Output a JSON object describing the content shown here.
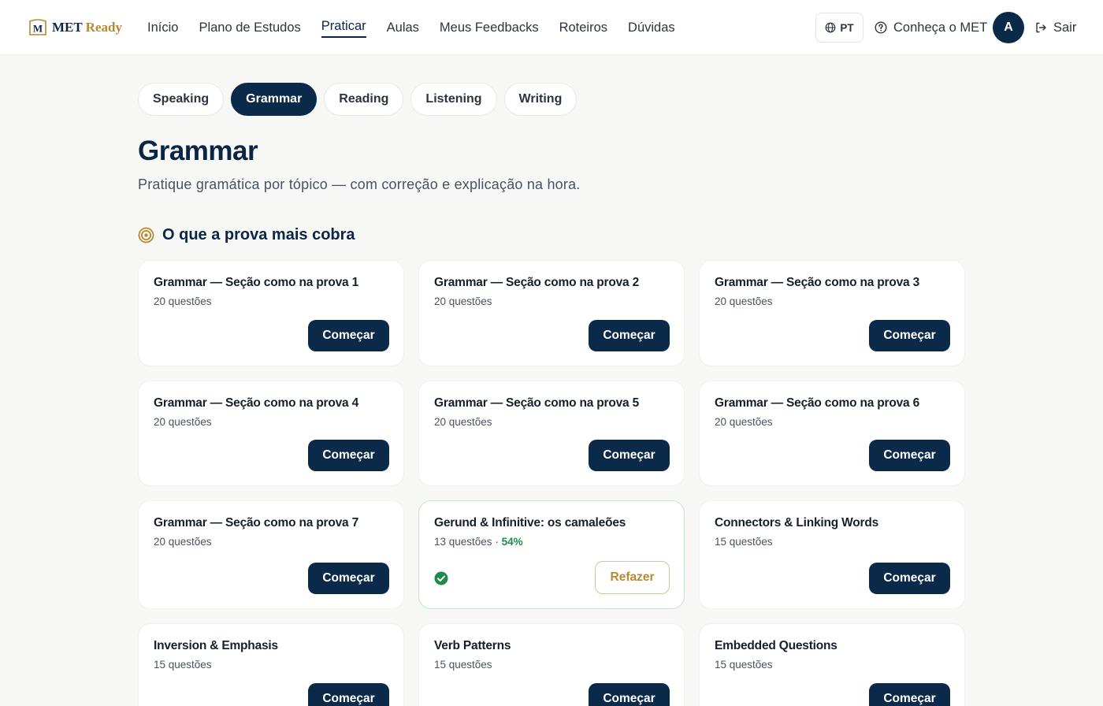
{
  "brand": {
    "name_prefix": "MET",
    "name_suffix": "Ready",
    "mark_letter": "M",
    "accent": "#b8892f",
    "primary": "#0b2a4a"
  },
  "nav": {
    "items": [
      "Início",
      "Plano de Estudos",
      "Praticar",
      "Aulas",
      "Meus Feedbacks",
      "Roteiros",
      "Dúvidas"
    ],
    "active": "Praticar",
    "language": "PT",
    "about": "Conheça o MET",
    "avatar_initial": "A",
    "logout": "Sair"
  },
  "skill_tabs": [
    "Speaking",
    "Grammar",
    "Reading",
    "Listening",
    "Writing"
  ],
  "active_skill": "Grammar",
  "page": {
    "title": "Grammar",
    "subtitle": "Pratique gramática por tópico — com correção e explicação na hora."
  },
  "section": {
    "title": "O que a prova mais cobra",
    "icon": "target-icon"
  },
  "cards": [
    {
      "title": "Grammar — Seção como na prova 1",
      "meta": "20 questões",
      "action": "Começar"
    },
    {
      "title": "Grammar — Seção como na prova 2",
      "meta": "20 questões",
      "action": "Começar"
    },
    {
      "title": "Grammar — Seção como na prova 3",
      "meta": "20 questões",
      "action": "Começar"
    },
    {
      "title": "Grammar — Seção como na prova 4",
      "meta": "20 questões",
      "action": "Começar"
    },
    {
      "title": "Grammar — Seção como na prova 5",
      "meta": "20 questões",
      "action": "Começar"
    },
    {
      "title": "Grammar — Seção como na prova 6",
      "meta": "20 questões",
      "action": "Começar"
    },
    {
      "title": "Grammar — Seção como na prova 7",
      "meta": "20 questões",
      "action": "Começar"
    },
    {
      "title": "Gerund & Infinitive: os camaleões",
      "meta": "13 questões",
      "score": "54%",
      "completed": true,
      "action": "Refazer"
    },
    {
      "title": "Connectors & Linking Words",
      "meta": "15 questões",
      "action": "Começar"
    },
    {
      "title": "Inversion & Emphasis",
      "meta": "15 questões",
      "action": "Começar"
    },
    {
      "title": "Verb Patterns",
      "meta": "15 questões",
      "action": "Começar"
    },
    {
      "title": "Embedded Questions",
      "meta": "15 questões",
      "action": "Começar"
    }
  ],
  "score_separator": "·",
  "colors": {
    "completed_green": "#1e8a4c",
    "completed_border": "#bfe6cf",
    "page_bg": "#f7f7f6"
  }
}
